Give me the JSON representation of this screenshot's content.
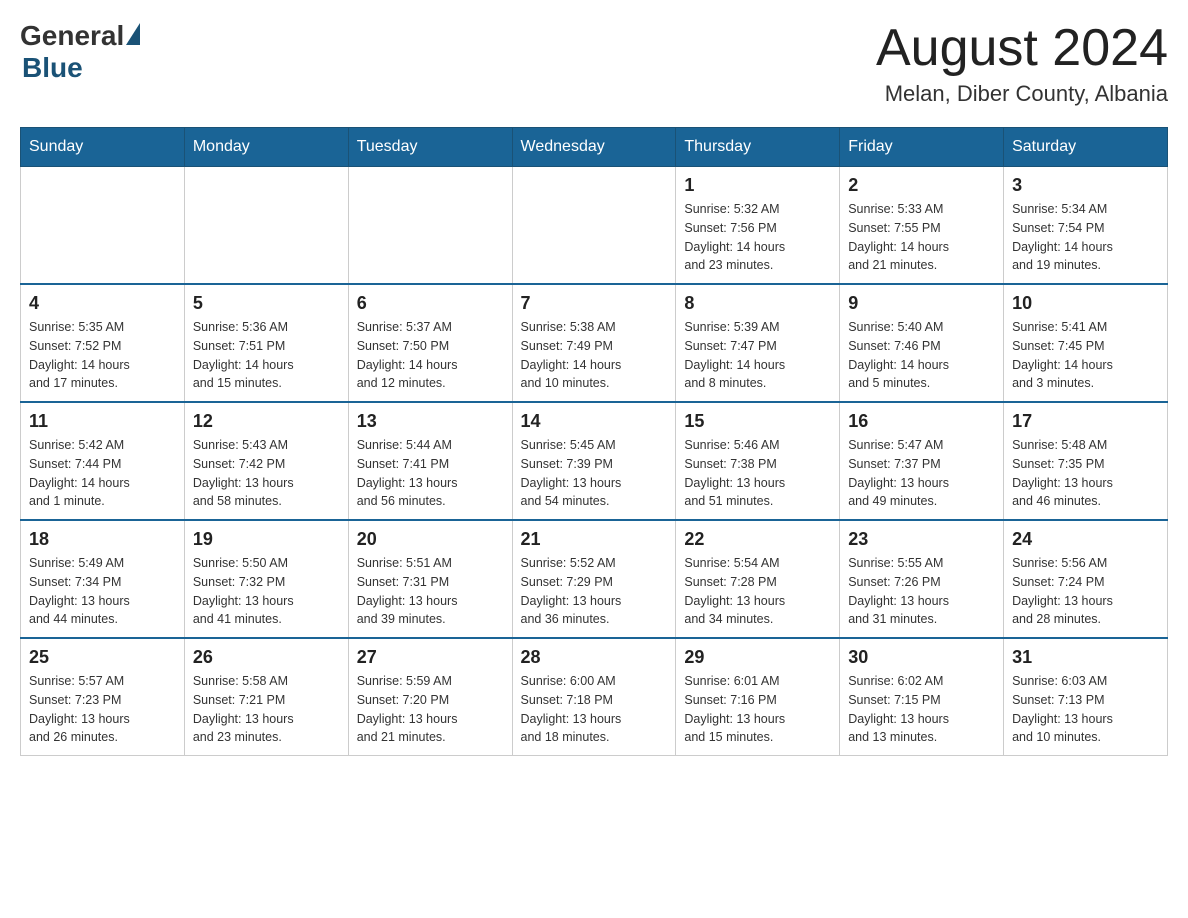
{
  "header": {
    "logo": {
      "general_text": "General",
      "blue_text": "Blue"
    },
    "title": "August 2024",
    "subtitle": "Melan, Diber County, Albania"
  },
  "days_of_week": [
    "Sunday",
    "Monday",
    "Tuesday",
    "Wednesday",
    "Thursday",
    "Friday",
    "Saturday"
  ],
  "weeks": [
    [
      {
        "day": "",
        "info": ""
      },
      {
        "day": "",
        "info": ""
      },
      {
        "day": "",
        "info": ""
      },
      {
        "day": "",
        "info": ""
      },
      {
        "day": "1",
        "info": "Sunrise: 5:32 AM\nSunset: 7:56 PM\nDaylight: 14 hours\nand 23 minutes."
      },
      {
        "day": "2",
        "info": "Sunrise: 5:33 AM\nSunset: 7:55 PM\nDaylight: 14 hours\nand 21 minutes."
      },
      {
        "day": "3",
        "info": "Sunrise: 5:34 AM\nSunset: 7:54 PM\nDaylight: 14 hours\nand 19 minutes."
      }
    ],
    [
      {
        "day": "4",
        "info": "Sunrise: 5:35 AM\nSunset: 7:52 PM\nDaylight: 14 hours\nand 17 minutes."
      },
      {
        "day": "5",
        "info": "Sunrise: 5:36 AM\nSunset: 7:51 PM\nDaylight: 14 hours\nand 15 minutes."
      },
      {
        "day": "6",
        "info": "Sunrise: 5:37 AM\nSunset: 7:50 PM\nDaylight: 14 hours\nand 12 minutes."
      },
      {
        "day": "7",
        "info": "Sunrise: 5:38 AM\nSunset: 7:49 PM\nDaylight: 14 hours\nand 10 minutes."
      },
      {
        "day": "8",
        "info": "Sunrise: 5:39 AM\nSunset: 7:47 PM\nDaylight: 14 hours\nand 8 minutes."
      },
      {
        "day": "9",
        "info": "Sunrise: 5:40 AM\nSunset: 7:46 PM\nDaylight: 14 hours\nand 5 minutes."
      },
      {
        "day": "10",
        "info": "Sunrise: 5:41 AM\nSunset: 7:45 PM\nDaylight: 14 hours\nand 3 minutes."
      }
    ],
    [
      {
        "day": "11",
        "info": "Sunrise: 5:42 AM\nSunset: 7:44 PM\nDaylight: 14 hours\nand 1 minute."
      },
      {
        "day": "12",
        "info": "Sunrise: 5:43 AM\nSunset: 7:42 PM\nDaylight: 13 hours\nand 58 minutes."
      },
      {
        "day": "13",
        "info": "Sunrise: 5:44 AM\nSunset: 7:41 PM\nDaylight: 13 hours\nand 56 minutes."
      },
      {
        "day": "14",
        "info": "Sunrise: 5:45 AM\nSunset: 7:39 PM\nDaylight: 13 hours\nand 54 minutes."
      },
      {
        "day": "15",
        "info": "Sunrise: 5:46 AM\nSunset: 7:38 PM\nDaylight: 13 hours\nand 51 minutes."
      },
      {
        "day": "16",
        "info": "Sunrise: 5:47 AM\nSunset: 7:37 PM\nDaylight: 13 hours\nand 49 minutes."
      },
      {
        "day": "17",
        "info": "Sunrise: 5:48 AM\nSunset: 7:35 PM\nDaylight: 13 hours\nand 46 minutes."
      }
    ],
    [
      {
        "day": "18",
        "info": "Sunrise: 5:49 AM\nSunset: 7:34 PM\nDaylight: 13 hours\nand 44 minutes."
      },
      {
        "day": "19",
        "info": "Sunrise: 5:50 AM\nSunset: 7:32 PM\nDaylight: 13 hours\nand 41 minutes."
      },
      {
        "day": "20",
        "info": "Sunrise: 5:51 AM\nSunset: 7:31 PM\nDaylight: 13 hours\nand 39 minutes."
      },
      {
        "day": "21",
        "info": "Sunrise: 5:52 AM\nSunset: 7:29 PM\nDaylight: 13 hours\nand 36 minutes."
      },
      {
        "day": "22",
        "info": "Sunrise: 5:54 AM\nSunset: 7:28 PM\nDaylight: 13 hours\nand 34 minutes."
      },
      {
        "day": "23",
        "info": "Sunrise: 5:55 AM\nSunset: 7:26 PM\nDaylight: 13 hours\nand 31 minutes."
      },
      {
        "day": "24",
        "info": "Sunrise: 5:56 AM\nSunset: 7:24 PM\nDaylight: 13 hours\nand 28 minutes."
      }
    ],
    [
      {
        "day": "25",
        "info": "Sunrise: 5:57 AM\nSunset: 7:23 PM\nDaylight: 13 hours\nand 26 minutes."
      },
      {
        "day": "26",
        "info": "Sunrise: 5:58 AM\nSunset: 7:21 PM\nDaylight: 13 hours\nand 23 minutes."
      },
      {
        "day": "27",
        "info": "Sunrise: 5:59 AM\nSunset: 7:20 PM\nDaylight: 13 hours\nand 21 minutes."
      },
      {
        "day": "28",
        "info": "Sunrise: 6:00 AM\nSunset: 7:18 PM\nDaylight: 13 hours\nand 18 minutes."
      },
      {
        "day": "29",
        "info": "Sunrise: 6:01 AM\nSunset: 7:16 PM\nDaylight: 13 hours\nand 15 minutes."
      },
      {
        "day": "30",
        "info": "Sunrise: 6:02 AM\nSunset: 7:15 PM\nDaylight: 13 hours\nand 13 minutes."
      },
      {
        "day": "31",
        "info": "Sunrise: 6:03 AM\nSunset: 7:13 PM\nDaylight: 13 hours\nand 10 minutes."
      }
    ]
  ]
}
